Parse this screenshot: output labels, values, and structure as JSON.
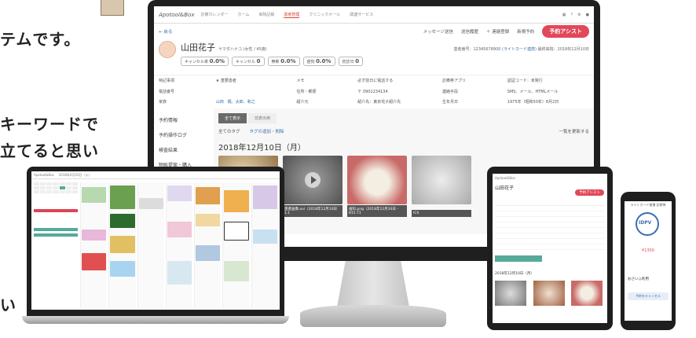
{
  "background_text": {
    "line1": "テムです。",
    "line2": "キーワードで",
    "line3": "立てると思い",
    "line4": "い"
  },
  "monitor": {
    "app_logo": "Apotool&Box",
    "nav": [
      "診療カレンダー",
      "ホーム",
      "来院記録",
      "患者管理",
      "クリニックメール",
      "関連サービス"
    ],
    "back": "← 戻る",
    "actions": {
      "message": "メッセージ送信",
      "history": "送信履歴",
      "register": "＋ 連絡登録",
      "print": "新規予約",
      "assist": "予約アシスト"
    },
    "patient": {
      "name": "山田花子",
      "kana": "ヤマダハナコ (女性 / 45歳)",
      "id_line": "患者番号：12345678900",
      "card": "(ライトカード連携)",
      "last_visit": "最終来院：2018年12月10日",
      "stats": [
        {
          "label": "キャンセル率",
          "value": "0.0%"
        },
        {
          "label": "キャンセル",
          "value": "0"
        },
        {
          "label": "無断",
          "value": "0.0%"
        },
        {
          "label": "遅刻",
          "value": "0.0%"
        },
        {
          "label": "初診日",
          "value": "0"
        }
      ]
    },
    "info": [
      "特記事項",
      "★ 重要患者",
      "メモ",
      "必ず前日に電話する",
      "診療券アプリ",
      "認証コード：未発行",
      "電話番号",
      "",
      "住所・郵便",
      "〒 0901234134",
      "連絡手段",
      "SMS、メール、HTMLメール",
      "家族",
      "山田　楓、太郎、和之",
      "紹介元",
      "紹介先：東京花子紹介先",
      "生年月日",
      "1975年（昭和50年）8月2日"
    ],
    "sidebar": [
      "予約情報",
      "予約操作ログ",
      "検査結果",
      "物販提案・購入"
    ],
    "tabs": [
      "全て表示",
      "非表示用"
    ],
    "filter": {
      "tag": "全てのタグ",
      "link": "タグの追加・削除",
      "sort": "一覧を更新する"
    },
    "date": "2018年12月10日（月）",
    "captions": [
      "2018年12月10日 - 19:5",
      "患者画像.avi（2018年12月10日 1.1",
      "歯科.png（2018年12月10日 - 815.71",
      "ICII"
    ]
  },
  "laptop": {
    "header": "2018年4月10日（火）",
    "cols": [
      "ドクター",
      "チェア1",
      "チェア2",
      "チェア3",
      "チェア4",
      "チェア5",
      "チェア6"
    ]
  },
  "tablet": {
    "logo": "Apotool&Box",
    "name": "山田花子",
    "assist": "予約アシスト",
    "date": "2018年12月10日（月）"
  },
  "phone": {
    "title": "ライトカード連携 診察券",
    "logo": "IDPV",
    "amount": "¥1350",
    "label": "予約をキャンセル",
    "option": "おさいふ利用"
  },
  "colors": {
    "accent": "#e2475a",
    "link": "#3a6fb0",
    "bezel": "#1f1f1f"
  }
}
